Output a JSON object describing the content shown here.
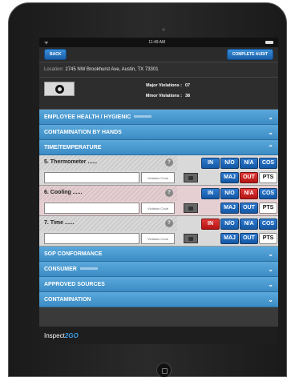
{
  "status": {
    "time": "11:49 AM"
  },
  "toolbar": {
    "back_label": "BACK",
    "complete_label": "COMPLETE AUDIT"
  },
  "location": {
    "label": "Location:",
    "value": "2745 NW Brookhurst Ave, Austin, TX 73301"
  },
  "violations": {
    "major_label": "Major Violations :",
    "major_value": "07",
    "minor_label": "Minor Violations :",
    "minor_value": "38"
  },
  "sections": [
    {
      "label": "EMPLOYEE HEALTH / HYGIENIC",
      "chevron": "⌄"
    },
    {
      "label": "CONTAMINATION BY HANDS",
      "chevron": "⌄"
    },
    {
      "label": "TIME/TEMPERATURE",
      "chevron": "⌃"
    },
    {
      "label": "SOP CONFORMANCE",
      "chevron": "⌄"
    },
    {
      "label": "CONSUMER",
      "chevron": "⌄"
    },
    {
      "label": "APPROVED SOURCES",
      "chevron": "⌄"
    },
    {
      "label": "CONTAMINATION",
      "chevron": "⌄"
    }
  ],
  "items": [
    {
      "title": "5. Thermometer ......",
      "code_placeholder": "Violation Code",
      "options": [
        "IN",
        "N/O",
        "N/A",
        "COS",
        "MAJ",
        "OUT",
        "PTS"
      ],
      "selected": "OUT"
    },
    {
      "title": "6. Cooling ......",
      "code_placeholder": "Violation Code",
      "options": [
        "IN",
        "N/O",
        "N/A",
        "COS",
        "MAJ",
        "OUT",
        "PTS"
      ],
      "selected": "N/A"
    },
    {
      "title": "7. Time ......",
      "code_placeholder": "Violation Code",
      "options": [
        "IN",
        "N/O",
        "N/A",
        "COS",
        "MAJ",
        "OUT",
        "PTS"
      ],
      "selected": "IN"
    }
  ],
  "footer": {
    "brand_a": "Inspect",
    "brand_b": "2GO"
  },
  "colors": {
    "section_blue": "#3c8cc4",
    "option_blue": "#1458a5",
    "selected_red": "#d42222"
  }
}
